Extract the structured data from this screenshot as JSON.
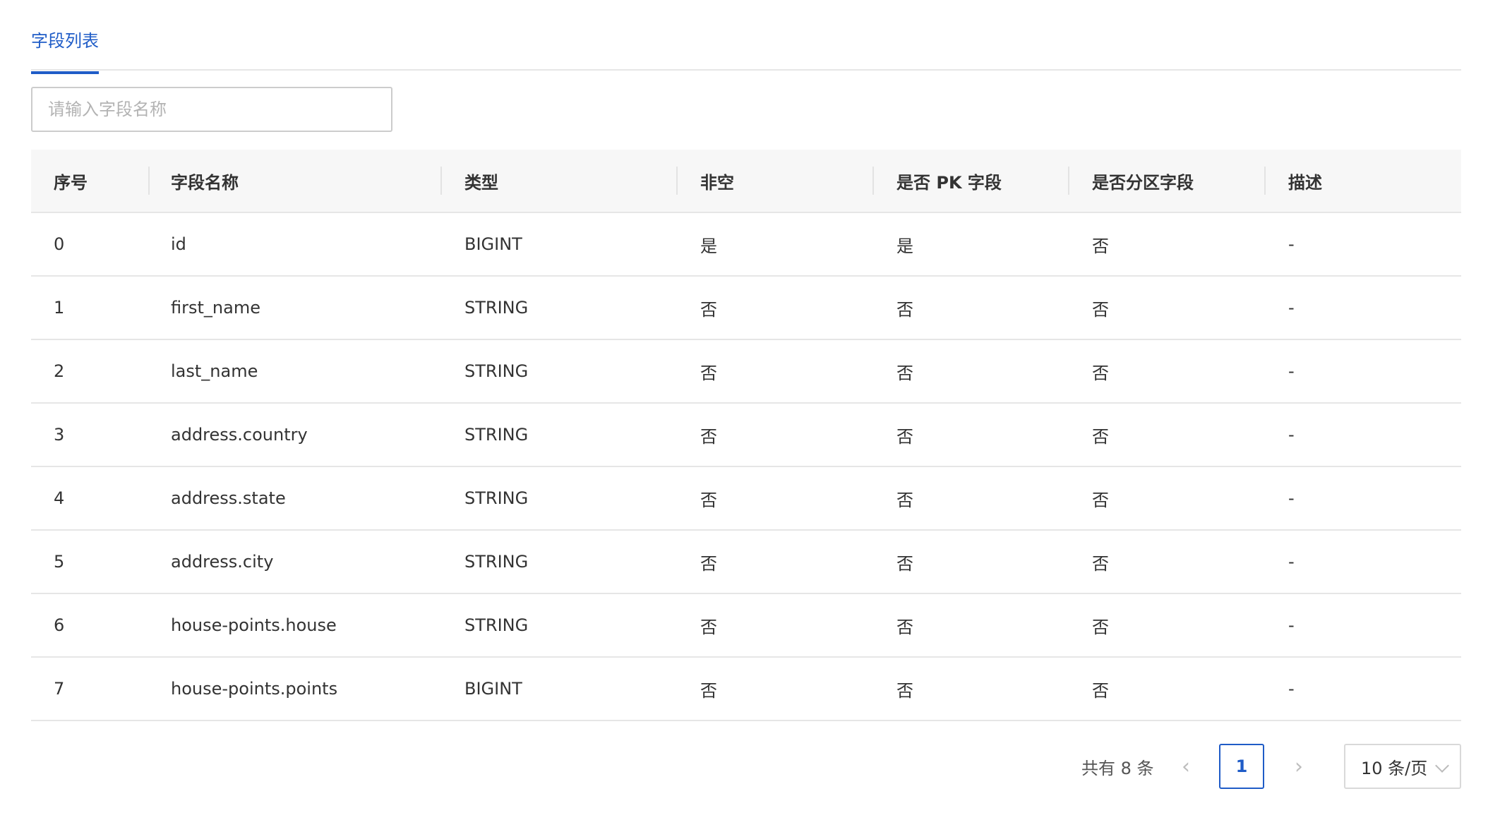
{
  "tabs": {
    "active_label": "字段列表"
  },
  "search": {
    "placeholder": "请输入字段名称",
    "value": ""
  },
  "table": {
    "columns": [
      "序号",
      "字段名称",
      "类型",
      "非空",
      "是否 PK 字段",
      "是否分区字段",
      "描述"
    ],
    "rows": [
      [
        "0",
        "id",
        "BIGINT",
        "是",
        "是",
        "否",
        "-"
      ],
      [
        "1",
        "first_name",
        "STRING",
        "否",
        "否",
        "否",
        "-"
      ],
      [
        "2",
        "last_name",
        "STRING",
        "否",
        "否",
        "否",
        "-"
      ],
      [
        "3",
        "address.country",
        "STRING",
        "否",
        "否",
        "否",
        "-"
      ],
      [
        "4",
        "address.state",
        "STRING",
        "否",
        "否",
        "否",
        "-"
      ],
      [
        "5",
        "address.city",
        "STRING",
        "否",
        "否",
        "否",
        "-"
      ],
      [
        "6",
        "house-points.house",
        "STRING",
        "否",
        "否",
        "否",
        "-"
      ],
      [
        "7",
        "house-points.points",
        "BIGINT",
        "否",
        "否",
        "否",
        "-"
      ]
    ]
  },
  "pagination": {
    "total_label": "共有 8 条",
    "prev_icon": "chevron-left-icon",
    "next_icon": "chevron-right-icon",
    "current_page": "1",
    "page_size_label": "10 条/页"
  },
  "colors": {
    "accent": "#1f5cc7",
    "header_bg": "#f7f7f7",
    "border": "#e6e6e6"
  }
}
